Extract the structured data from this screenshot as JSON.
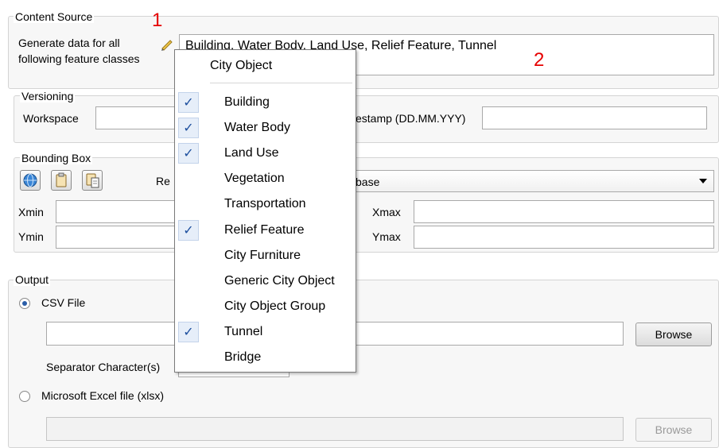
{
  "content_source": {
    "legend": "Content Source",
    "generate_label_line1": "Generate data for all",
    "generate_label_line2": "following feature classes",
    "feature_classes_value": "Building, Water Body, Land Use, Relief Feature, Tunnel"
  },
  "annotations": {
    "one": "1",
    "two": "2"
  },
  "versioning": {
    "legend": "Versioning",
    "workspace_label": "Workspace",
    "timestamp_label": "Timestamp (DD.MM.YYY)",
    "timestamp_visible": "estamp (DD.MM.YYY)"
  },
  "bounding_box": {
    "legend": "Bounding Box",
    "reference_label_visible": "Re",
    "reference_select_visible": "base",
    "xmin_label": "Xmin",
    "ymin_label": "Ymin",
    "xmax_label": "Xmax",
    "ymax_label": "Ymax",
    "icons": [
      "globe-icon",
      "clipboard-icon",
      "paste-icon"
    ]
  },
  "output": {
    "legend": "Output",
    "csv_label": "CSV File",
    "csv_selected": true,
    "browse_label": "Browse",
    "separator_label": "Separator Character(s)",
    "excel_label": "Microsoft Excel file (xlsx)",
    "excel_selected": false,
    "excel_browse_label": "Browse"
  },
  "menu": {
    "title": "City Object",
    "items": [
      {
        "label": "Building",
        "checked": true
      },
      {
        "label": "Water Body",
        "checked": true
      },
      {
        "label": "Land Use",
        "checked": true
      },
      {
        "label": "Vegetation",
        "checked": false
      },
      {
        "label": "Transportation",
        "checked": false
      },
      {
        "label": "Relief Feature",
        "checked": true
      },
      {
        "label": "City Furniture",
        "checked": false
      },
      {
        "label": "Generic City Object",
        "checked": false
      },
      {
        "label": "City Object Group",
        "checked": false
      },
      {
        "label": "Tunnel",
        "checked": true
      },
      {
        "label": "Bridge",
        "checked": false
      }
    ],
    "check_glyph": "✓"
  },
  "colors": {
    "annotation": "#e60000",
    "check": "#1d4f9e",
    "radio_selected": "#2a5ea8"
  }
}
